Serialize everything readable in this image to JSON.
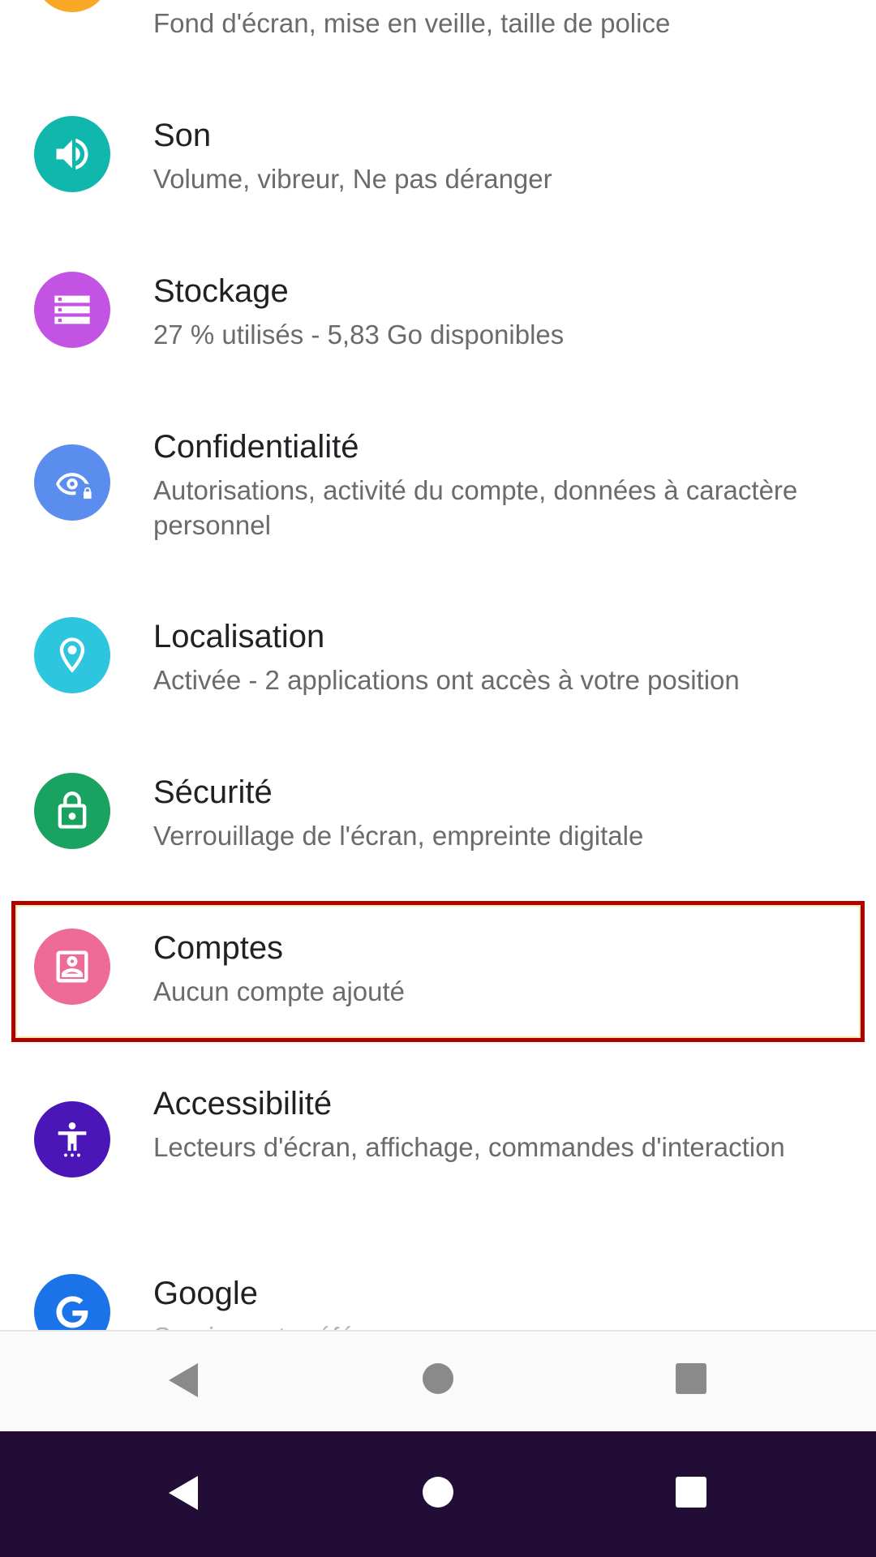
{
  "settings": [
    {
      "key": "affichage",
      "title": "",
      "subtitle": "Fond d'écran, mise en veille, taille de police",
      "icon": "brightness-icon",
      "color": "#F9A825"
    },
    {
      "key": "son",
      "title": "Son",
      "subtitle": "Volume, vibreur, Ne pas déranger",
      "icon": "volume-icon",
      "color": "#0FB7AC"
    },
    {
      "key": "stockage",
      "title": "Stockage",
      "subtitle": "27 % utilisés - 5,83 Go disponibles",
      "icon": "storage-icon",
      "color": "#C354E3"
    },
    {
      "key": "confidentialite",
      "title": "Confidentialité",
      "subtitle": "Autorisations, activité du compte, données à caractère personnel",
      "icon": "privacy-eye-lock-icon",
      "color": "#5B8DEF"
    },
    {
      "key": "localisation",
      "title": "Localisation",
      "subtitle": "Activée - 2 applications ont accès à votre position",
      "icon": "location-pin-icon",
      "color": "#2EC6DE"
    },
    {
      "key": "securite",
      "title": "Sécurité",
      "subtitle": "Verrouillage de l'écran, empreinte digitale",
      "icon": "lock-icon",
      "color": "#1AA260"
    },
    {
      "key": "comptes",
      "title": "Comptes",
      "subtitle": "Aucun compte ajouté",
      "icon": "account-box-icon",
      "color": "#EE6B97"
    },
    {
      "key": "accessibilite",
      "title": "Accessibilité",
      "subtitle": "Lecteurs d'écran, affichage, commandes d'interaction",
      "icon": "accessibility-icon",
      "color": "#4A16B8"
    },
    {
      "key": "google",
      "title": "Google",
      "subtitle": "Services et préférences",
      "icon": "google-g-icon",
      "color": "#1A73E8"
    }
  ],
  "highlight": {
    "color": "#B00000",
    "target": "comptes"
  },
  "nav_bars": {
    "light": {
      "background": "#FAFAFA",
      "icon_color": "#8A8A8A",
      "buttons": [
        "back-icon",
        "home-icon",
        "recents-icon"
      ]
    },
    "dark": {
      "background": "#220D36",
      "icon_color": "#FFFFFF",
      "buttons": [
        "back-icon",
        "home-icon",
        "recents-icon"
      ]
    }
  }
}
